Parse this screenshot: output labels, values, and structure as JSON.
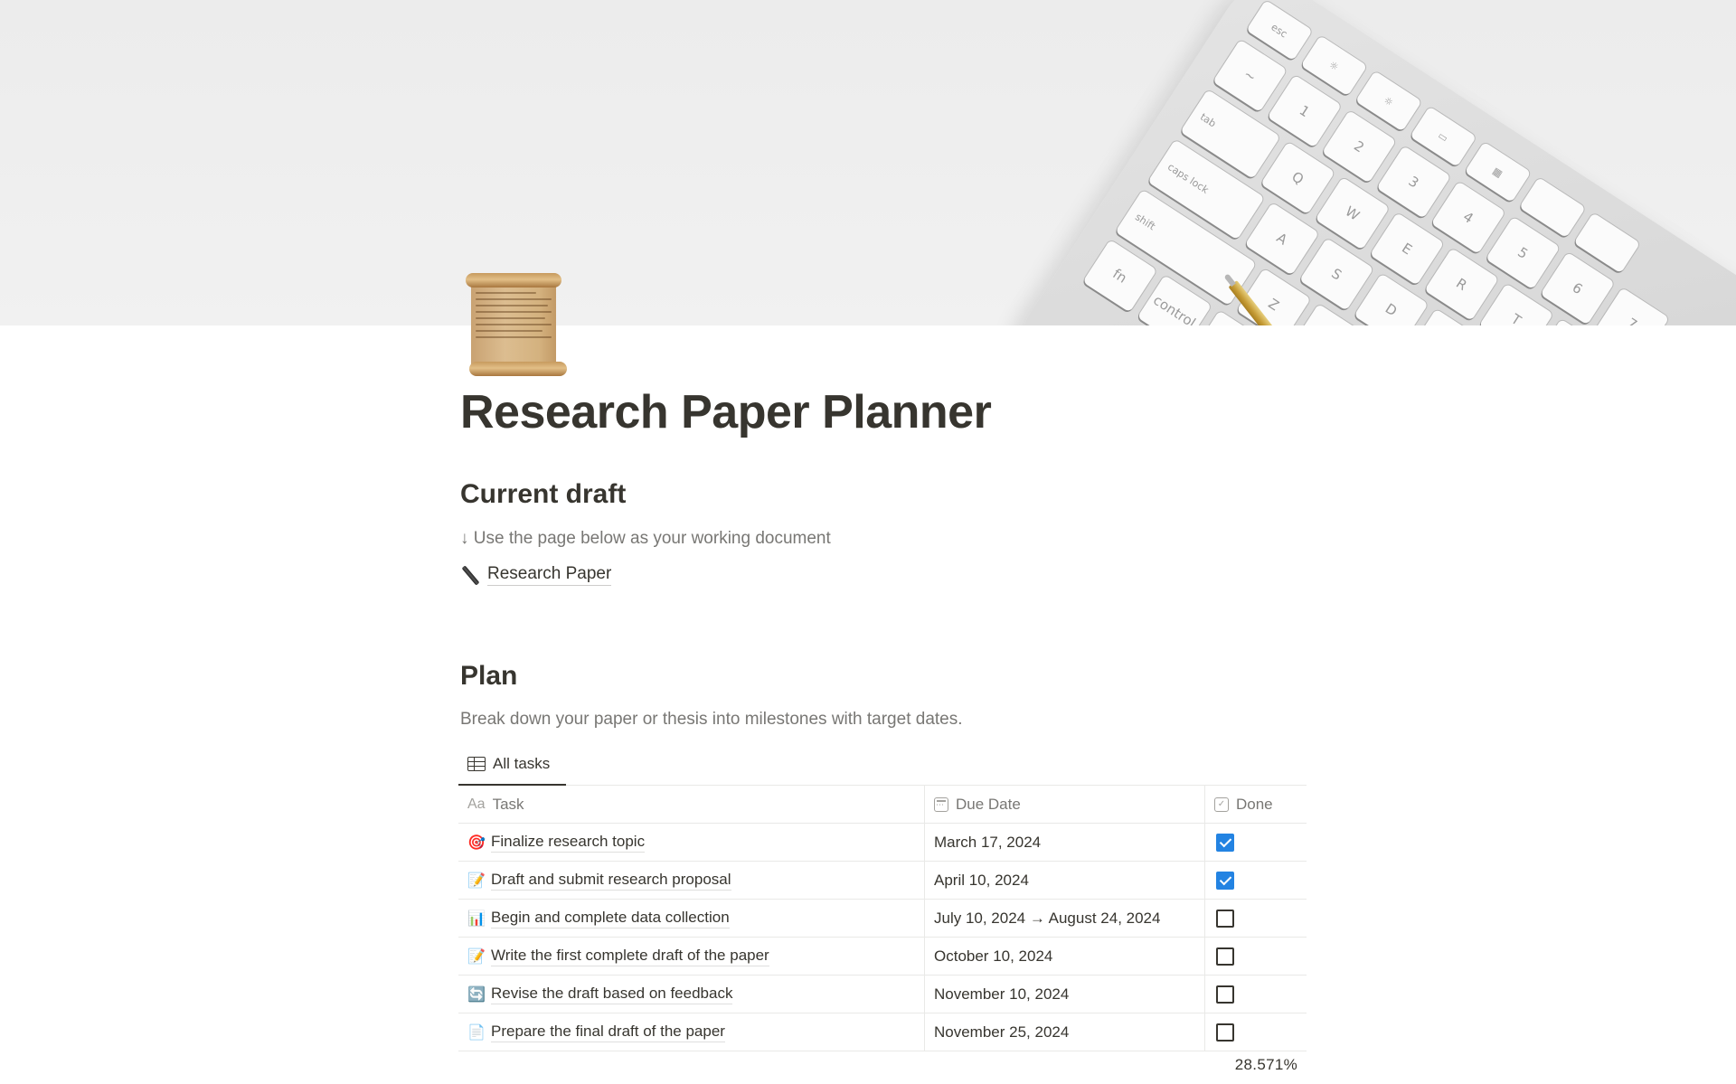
{
  "cover": {
    "description": "white keyboard and gold pen on light gray desk",
    "icon": "keyboard-cover"
  },
  "page": {
    "icon": "scroll-icon",
    "title": "Research Paper Planner"
  },
  "current_draft": {
    "heading": "Current draft",
    "hint": "↓ Use the page below as your working document",
    "link": {
      "icon": "fountain-pen-icon",
      "label": "Research Paper"
    }
  },
  "plan": {
    "heading": "Plan",
    "description": "Break down your paper or thesis into milestones with target dates.",
    "views": [
      {
        "label": "All tasks",
        "icon": "table-icon",
        "active": true
      }
    ],
    "columns": {
      "task": {
        "icon_text": "Aa",
        "label": "Task"
      },
      "due": {
        "icon": "calendar-icon",
        "label": "Due Date"
      },
      "done": {
        "icon": "checkbox-icon",
        "label": "Done"
      }
    },
    "rows": [
      {
        "emoji": "🎯",
        "emoji_name": "target-icon",
        "task": "Finalize research topic",
        "due": "March 17, 2024",
        "done": true
      },
      {
        "emoji": "📝",
        "emoji_name": "memo-icon",
        "task": "Draft and submit research proposal",
        "due": "April 10, 2024",
        "done": true
      },
      {
        "emoji": "📊",
        "emoji_name": "bar-chart-icon",
        "task": "Begin and complete data collection",
        "due": "July 10, 2024 → August 24, 2024",
        "done": false
      },
      {
        "emoji": "📝",
        "emoji_name": "memo-icon",
        "task": "Write the first complete draft of the paper",
        "due": "October 10, 2024",
        "done": false
      },
      {
        "emoji": "🔄",
        "emoji_name": "refresh-icon",
        "task": "Revise the draft based on feedback",
        "due": "November 10, 2024",
        "done": false
      },
      {
        "emoji": "📄",
        "emoji_name": "document-icon",
        "task": "Prepare the final draft of the paper",
        "due": "November 25, 2024",
        "done": false
      }
    ],
    "done_percent": "28.571%"
  },
  "colors": {
    "checkbox_checked": "#2383e2",
    "text": "#37352f",
    "muted": "#787774"
  }
}
